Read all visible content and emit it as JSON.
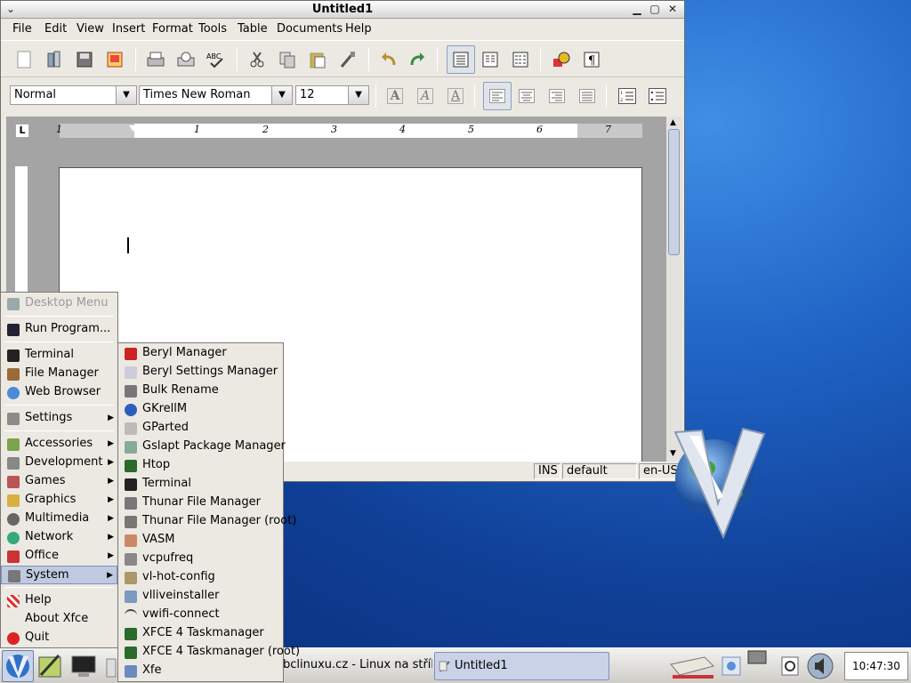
{
  "window": {
    "title": "Untitled1",
    "controls": [
      "chevron-down",
      "minimize",
      "maximize",
      "close"
    ]
  },
  "menubar": [
    "File",
    "Edit",
    "View",
    "Insert",
    "Format",
    "Tools",
    "Table",
    "Documents",
    "Help"
  ],
  "toolbar1": [
    "new",
    "open",
    "save",
    "export-pdf",
    "print",
    "print-preview",
    "spellcheck",
    "cut",
    "copy",
    "paste",
    "format-painter",
    "undo",
    "redo",
    "normal-layout",
    "web-layout",
    "page-layout",
    "insert-image",
    "show-formatting"
  ],
  "format": {
    "style": "Normal",
    "font": "Times New Roman",
    "size": "12",
    "bold": "A",
    "italic": "A",
    "underline": "A"
  },
  "ruler": {
    "numbers": [
      "1",
      "1",
      "2",
      "3",
      "4",
      "5",
      "6",
      "7"
    ],
    "corner": "L"
  },
  "status": {
    "ins": "INS",
    "style": "default",
    "lang": "en-US"
  },
  "start_menu": {
    "items": [
      {
        "label": "Desktop Menu",
        "disabled": true
      },
      {
        "label": "Run Program..."
      },
      {
        "label": "Terminal"
      },
      {
        "label": "File Manager"
      },
      {
        "label": "Web Browser"
      },
      {
        "label": "Settings",
        "sub": true
      },
      {
        "label": "Accessories",
        "sub": true
      },
      {
        "label": "Development",
        "sub": true
      },
      {
        "label": "Games",
        "sub": true
      },
      {
        "label": "Graphics",
        "sub": true
      },
      {
        "label": "Multimedia",
        "sub": true
      },
      {
        "label": "Network",
        "sub": true
      },
      {
        "label": "Office",
        "sub": true
      },
      {
        "label": "System",
        "sub": true,
        "selected": true
      },
      {
        "label": "Help"
      },
      {
        "label": "About Xfce"
      },
      {
        "label": "Quit"
      }
    ]
  },
  "system_menu": [
    "Beryl Manager",
    "Beryl Settings Manager",
    "Bulk Rename",
    "GKrellM",
    "GParted",
    "Gslapt Package Manager",
    "Htop",
    "Terminal",
    "Thunar File Manager",
    "Thunar File Manager (root)",
    "VASM",
    "vcpufreq",
    "vl-hot-config",
    "vlliveinstaller",
    "vwifi-connect",
    "XFCE 4 Taskmanager",
    "XFCE 4 Taskmanager (root)",
    "Xfe"
  ],
  "taskbar": {
    "tasks": [
      "bclinuxu.cz - Linux na stříbr...",
      "Untitled1"
    ],
    "clock": "10:47:30 PM"
  },
  "colors": {
    "accent": "#1f63c4",
    "menu_bg": "#ece9e3",
    "selection": "#bfcae0"
  }
}
